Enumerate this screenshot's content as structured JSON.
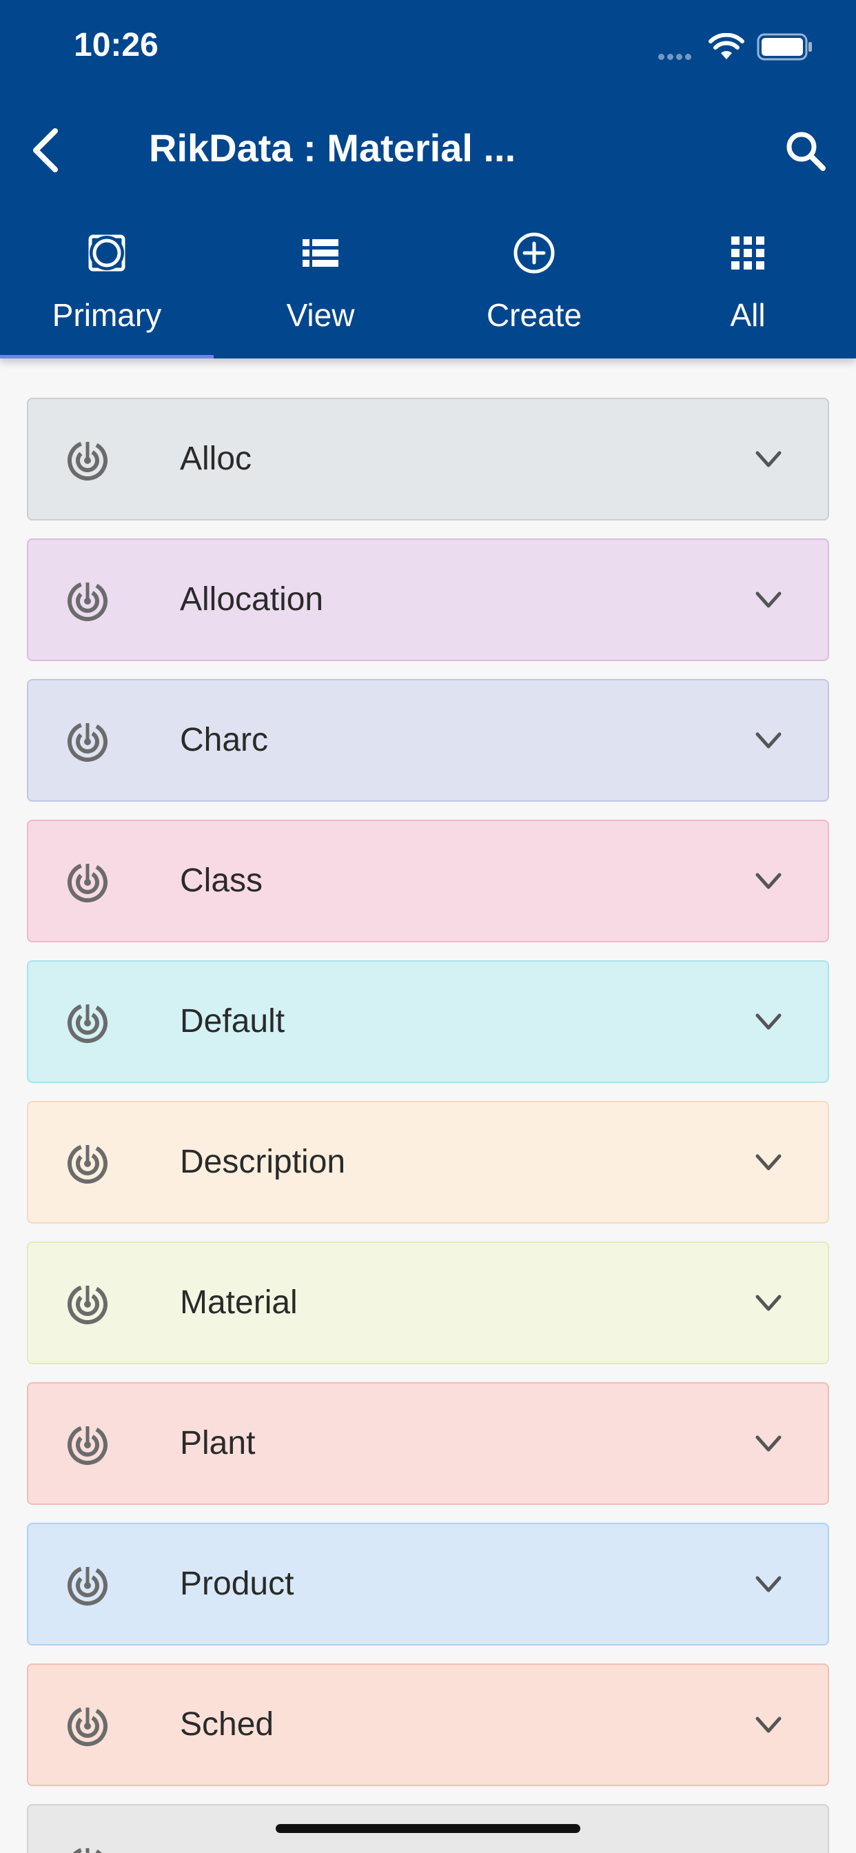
{
  "status_bar": {
    "time": "10:26"
  },
  "header": {
    "title": "RikData : Material ...",
    "back_icon": "chevron-left-icon",
    "search_icon": "search-icon",
    "background": "#02468e"
  },
  "tabs": [
    {
      "label": "Primary",
      "icon": "target-square-icon",
      "selected": true
    },
    {
      "label": "View",
      "icon": "list-icon",
      "selected": false
    },
    {
      "label": "Create",
      "icon": "plus-circle-icon",
      "selected": false
    },
    {
      "label": "All",
      "icon": "grid-icon",
      "selected": false
    }
  ],
  "sections": [
    {
      "label": "Alloc",
      "bg": "#e4e7ea",
      "border": "#c9ced3"
    },
    {
      "label": "Allocation",
      "bg": "#ecdcef",
      "border": "#dcb9e3"
    },
    {
      "label": "Charc",
      "bg": "#dfe2f1",
      "border": "#bfc6e6"
    },
    {
      "label": "Class",
      "bg": "#f8dae4",
      "border": "#efb9ca"
    },
    {
      "label": "Default",
      "bg": "#d4f1f4",
      "border": "#a9e3ea"
    },
    {
      "label": "Description",
      "bg": "#fcefe0",
      "border": "#f5dbbd"
    },
    {
      "label": "Material",
      "bg": "#f3f7e1",
      "border": "#e2ebbd"
    },
    {
      "label": "Plant",
      "bg": "#f9dedb",
      "border": "#efbdb8"
    },
    {
      "label": "Product",
      "bg": "#d8e8f8",
      "border": "#b0d1f1"
    },
    {
      "label": "Sched",
      "bg": "#fbe0d8",
      "border": "#f2bfb0"
    },
    {
      "label": "",
      "bg": "#e8e8e8",
      "border": "#d2d2d2"
    }
  ]
}
